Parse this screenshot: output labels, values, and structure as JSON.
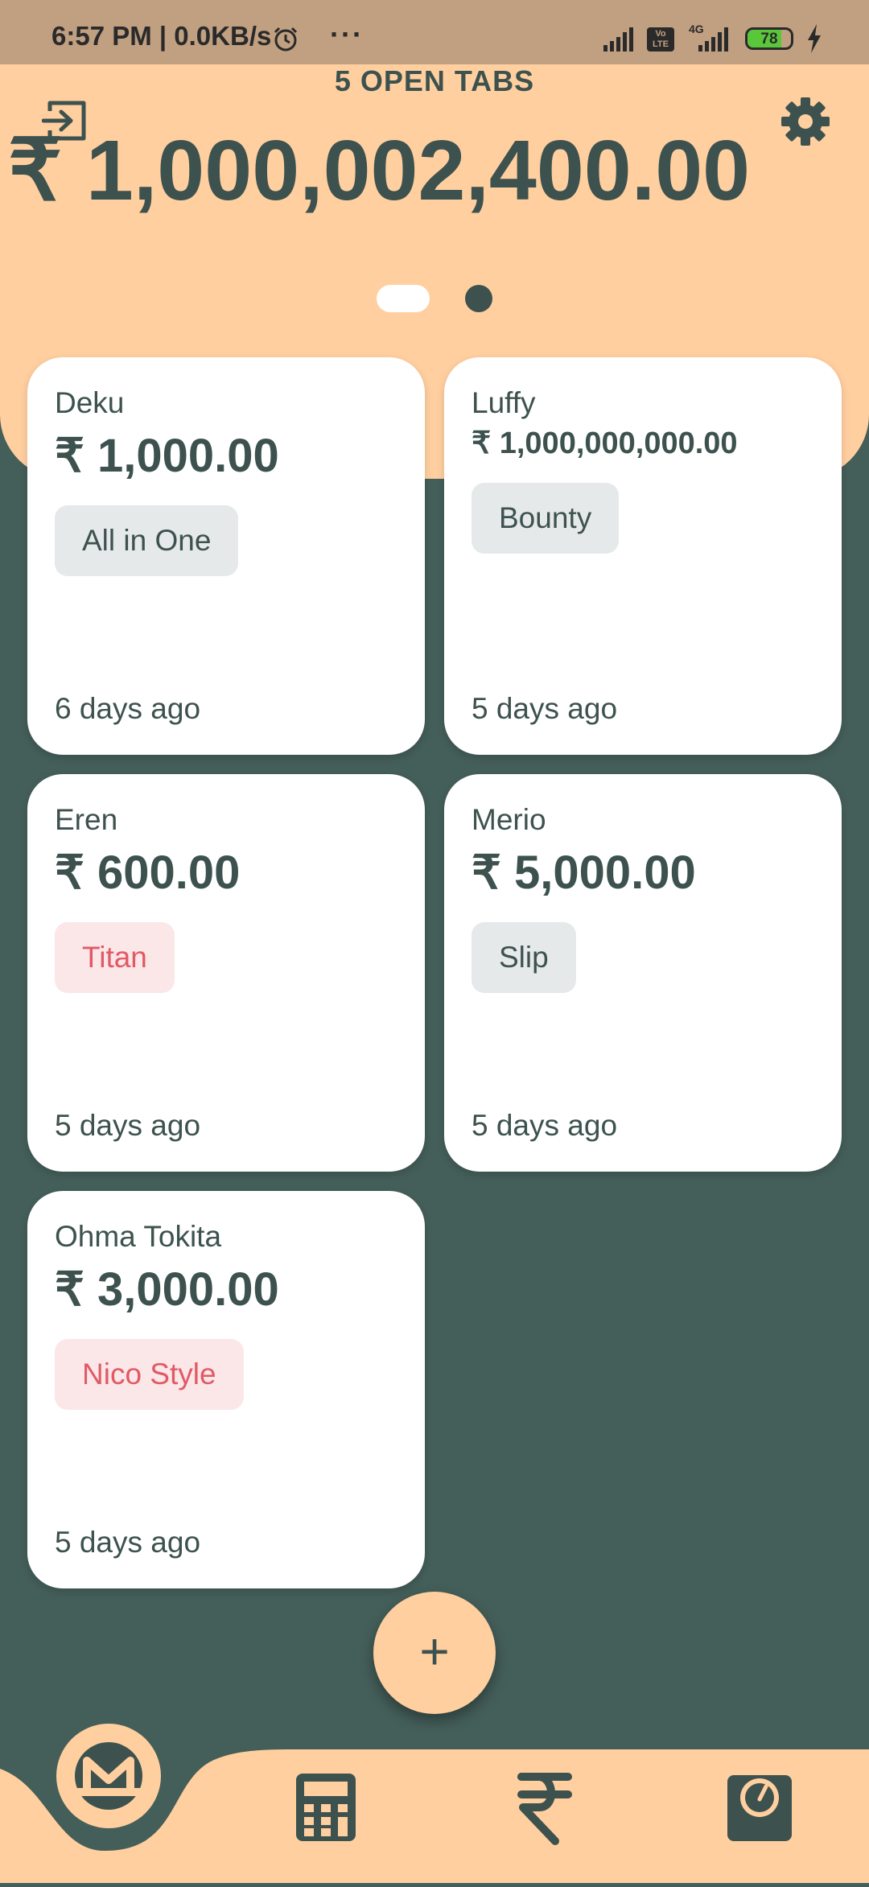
{
  "status_bar": {
    "time": "6:57 PM | 0.0KB/s",
    "more": "···",
    "volte": "Vo LTE",
    "network": "4G",
    "battery": "78",
    "battery_level": 0.78
  },
  "header": {
    "title": "5 OPEN TABS",
    "total": "₹ 1,000,002,400.00",
    "page_indicator": {
      "count": 2,
      "active": 1
    }
  },
  "tabs": [
    {
      "name": "Deku",
      "amount": "₹ 1,000.00",
      "tag": "All in One",
      "tag_style": "gray",
      "time": "6 days ago"
    },
    {
      "name": "Luffy",
      "amount": "₹ 1,000,000,000.00",
      "tag": "Bounty",
      "tag_style": "gray",
      "time": "5 days ago"
    },
    {
      "name": "Eren",
      "amount": "₹ 600.00",
      "tag": "Titan",
      "tag_style": "red",
      "time": "5 days ago"
    },
    {
      "name": "Merio",
      "amount": "₹ 5,000.00",
      "tag": "Slip",
      "tag_style": "gray",
      "time": "5 days ago"
    },
    {
      "name": "Ohma Tokita",
      "amount": "₹ 3,000.00",
      "tag": "Nico Style",
      "tag_style": "red",
      "time": "5 days ago"
    }
  ],
  "fab": {
    "label": "+"
  },
  "colors": {
    "accent": "#ffcfa0",
    "dark": "#445e59",
    "text": "#3d524e",
    "red_tag": "#e05a66"
  },
  "icons": {
    "logout": "logout-icon",
    "settings": "gear-icon",
    "home": "monero-icon",
    "calculator": "calculator-icon",
    "currency": "rupee-icon",
    "meter": "gauge-icon"
  }
}
